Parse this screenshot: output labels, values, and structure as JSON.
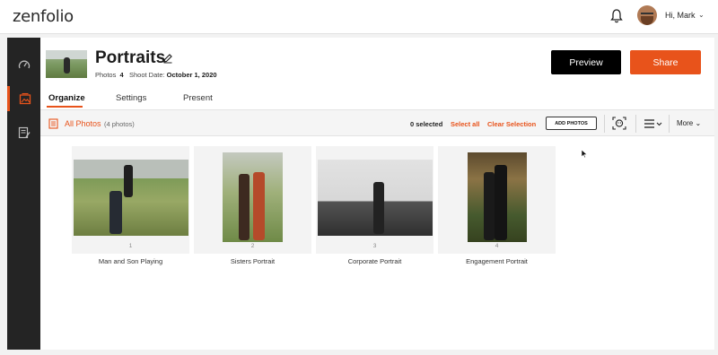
{
  "header": {
    "logo": "zenfolio",
    "greeting": "Hi, Mark",
    "bell_icon": "bell-icon",
    "account_chevron": "⌄"
  },
  "sidebar": {
    "items": [
      {
        "icon": "dashboard-icon"
      },
      {
        "icon": "photos-icon",
        "active": true
      },
      {
        "icon": "orders-icon"
      }
    ],
    "collapse_glyph": "›"
  },
  "gallery": {
    "title": "Portraits",
    "photos_label": "Photos",
    "photos_count": "4",
    "shoot_date_label": "Shoot Date:",
    "shoot_date": "October 1, 2020"
  },
  "actions": {
    "preview_label": "Preview",
    "share_label": "Share"
  },
  "tabs": [
    {
      "label": "Organize",
      "active": true
    },
    {
      "label": "Settings"
    },
    {
      "label": "Present"
    }
  ],
  "toolbar": {
    "all_photos_label": "All Photos",
    "photo_count": "(4 photos)",
    "selected": "0 selected",
    "select_all": "Select all",
    "clear_selection": "Clear Selection",
    "add_photos": "ADD PHOTOS",
    "more_label": "More",
    "more_chevron": "⌄",
    "view_chevron": "⌄"
  },
  "photos": [
    {
      "number": "1",
      "caption": "Man and Son Playing"
    },
    {
      "number": "2",
      "caption": "Sisters Portrait"
    },
    {
      "number": "3",
      "caption": "Corporate Portrait"
    },
    {
      "number": "4",
      "caption": "Engagement Portrait"
    }
  ],
  "colors": {
    "accent": "#e8531b",
    "sidebar": "#242424",
    "preview_button": "#000000"
  }
}
